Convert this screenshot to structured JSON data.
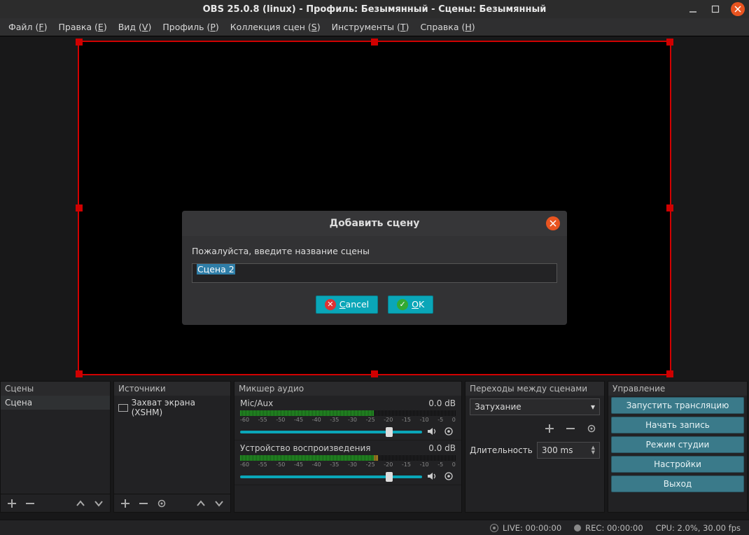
{
  "title": "OBS 25.0.8 (linux) - Профиль: Безымянный - Сцены: Безымянный",
  "menu": {
    "file": "Файл (F)",
    "edit": "Правка (E)",
    "view": "Вид (V)",
    "profile": "Профиль (P)",
    "scenecol": "Коллекция сцен (S)",
    "tools": "Инструменты (T)",
    "help": "Справка (H)"
  },
  "panels": {
    "scenes": {
      "title": "Сцены",
      "items": [
        "Сцена"
      ]
    },
    "sources": {
      "title": "Источники",
      "items": [
        "Захват экрана (XSHM)"
      ]
    },
    "mixer": {
      "title": "Микшер аудио",
      "ticks": [
        "-60",
        "-55",
        "-50",
        "-45",
        "-40",
        "-35",
        "-30",
        "-25",
        "-20",
        "-15",
        "-10",
        "-5",
        "0"
      ],
      "items": [
        {
          "name": "Mic/Aux",
          "level": "0.0 dB"
        },
        {
          "name": "Устройство воспроизведения",
          "level": "0.0 dB"
        }
      ]
    },
    "transitions": {
      "title": "Переходы между сценами",
      "current": "Затухание",
      "dur_label": "Длительность",
      "dur_value": "300 ms"
    },
    "controls": {
      "title": "Управление",
      "buttons": {
        "stream": "Запустить трансляцию",
        "record": "Начать запись",
        "studio": "Режим студии",
        "settings": "Настройки",
        "exit": "Выход"
      }
    }
  },
  "status": {
    "live": "LIVE: 00:00:00",
    "rec": "REC: 00:00:00",
    "cpu": "CPU: 2.0%, 30.00 fps"
  },
  "dialog": {
    "title": "Добавить сцену",
    "prompt": "Пожалуйста, введите название сцены",
    "value": "Сцена 2",
    "cancel": "Cancel",
    "ok": "OK"
  }
}
